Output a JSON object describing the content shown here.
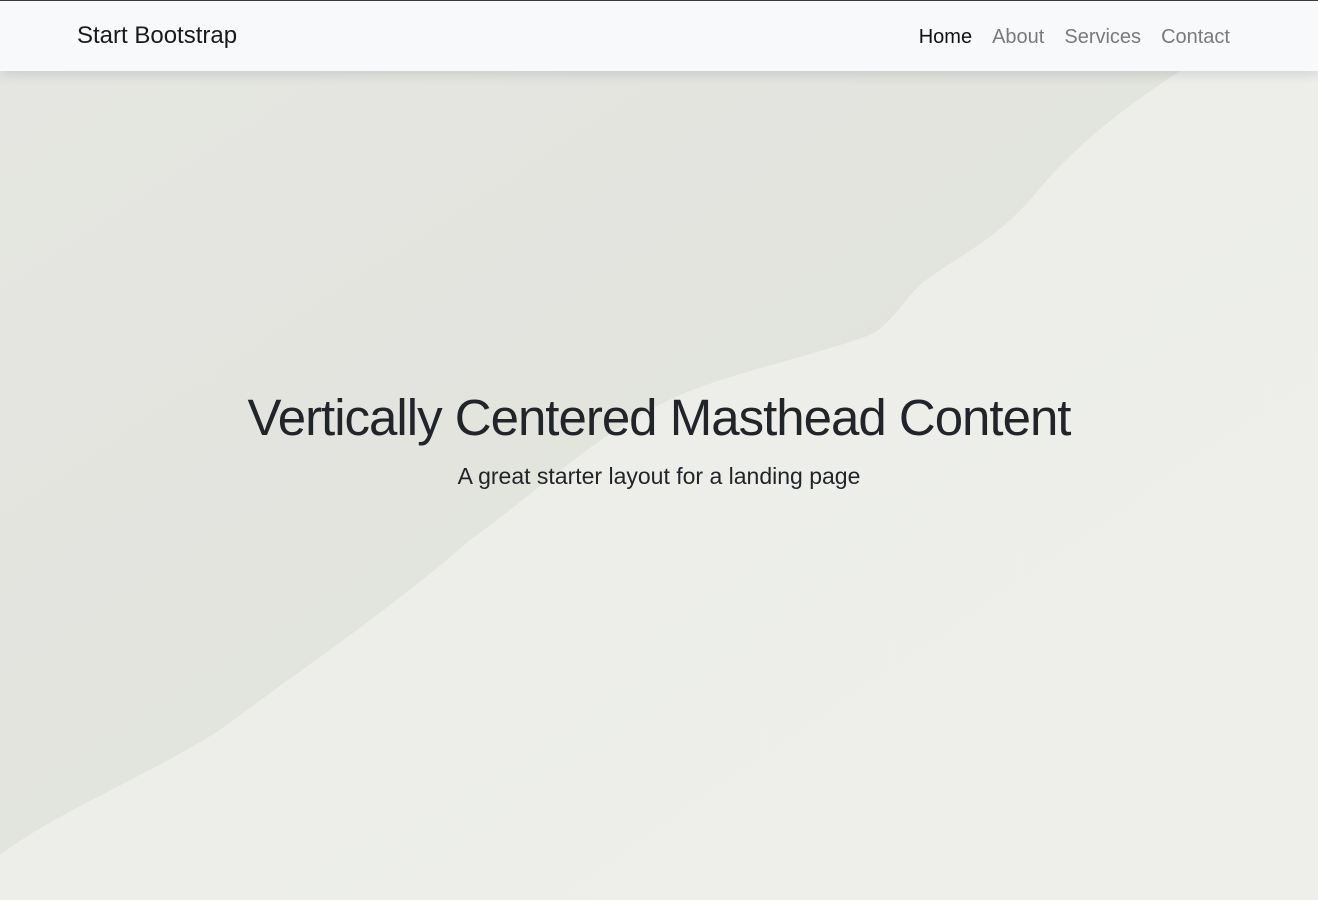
{
  "navbar": {
    "brand": "Start Bootstrap",
    "links": [
      {
        "label": "Home",
        "active": true
      },
      {
        "label": "About",
        "active": false
      },
      {
        "label": "Services",
        "active": false
      },
      {
        "label": "Contact",
        "active": false
      }
    ]
  },
  "masthead": {
    "heading": "Vertically Centered Masthead Content",
    "subheading": "A great starter layout for a landing page"
  },
  "colors": {
    "navbar_bg": "#f8f9fa",
    "text_dark": "#212529",
    "nav_muted": "#7a7a7a",
    "background_dark": "#e2e3dd",
    "background_light": "#edeeea"
  }
}
